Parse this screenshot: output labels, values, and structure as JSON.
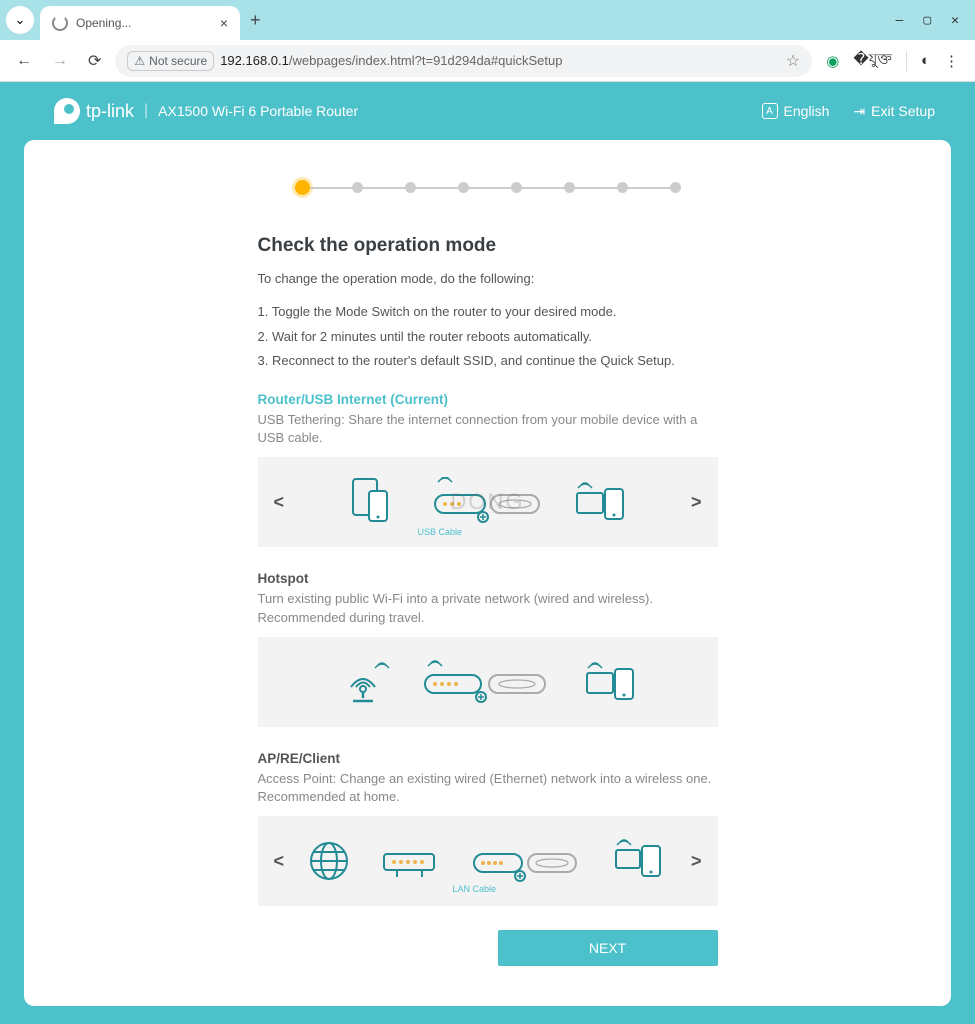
{
  "browser": {
    "tab_title": "Opening...",
    "not_secure": "Not secure",
    "url_host": "192.168.0.1",
    "url_path": "/webpages/index.html?t=91d294da#quickSetup"
  },
  "header": {
    "brand": "tp-link",
    "product": "AX1500 Wi-Fi 6 Portable Router",
    "language": "English",
    "exit": "Exit Setup"
  },
  "page": {
    "title": "Check the operation mode",
    "intro": "To change the operation mode, do the following:",
    "steps": [
      "1. Toggle the Mode Switch on the router to your desired mode.",
      "2. Wait for 2 minutes until the router reboots automatically.",
      "3. Reconnect to the router's default SSID, and continue the Quick Setup."
    ],
    "modes": [
      {
        "title": "Router/USB Internet (Current)",
        "desc": "USB Tethering: Share the internet connection from your mobile device with a USB cable.",
        "current": true,
        "carousel": true,
        "label": "USB Cable"
      },
      {
        "title": "Hotspot",
        "desc": "Turn existing public Wi-Fi into a private network (wired and wireless). Recommended during travel.",
        "current": false,
        "carousel": false
      },
      {
        "title": "AP/RE/Client",
        "desc": "Access Point: Change an existing wired (Ethernet) network into a wireless one. Recommended at home.",
        "current": false,
        "carousel": true,
        "label": "LAN Cable"
      }
    ],
    "next": "NEXT"
  },
  "watermark": "DONG"
}
